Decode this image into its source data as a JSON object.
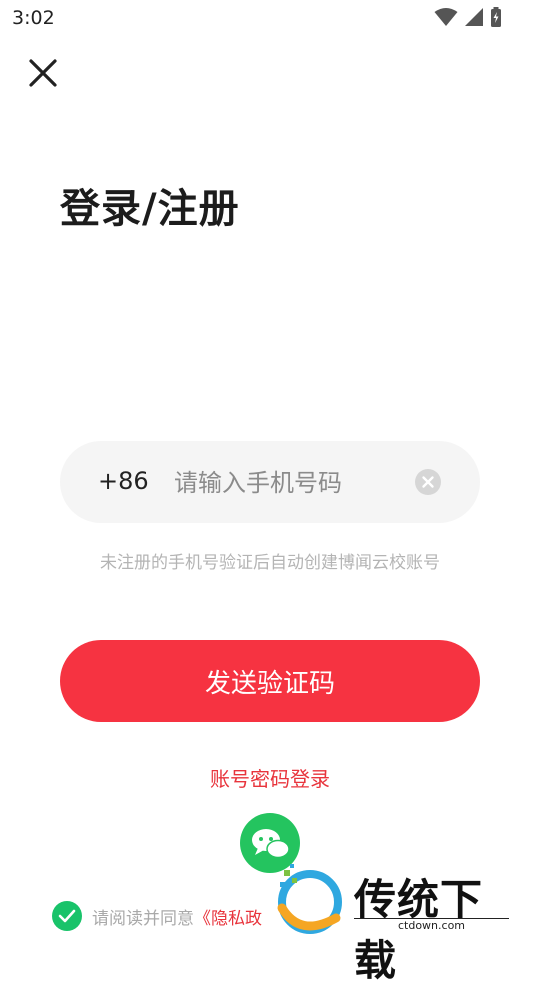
{
  "status_bar": {
    "time": "3:02"
  },
  "page": {
    "title": "登录/注册"
  },
  "phone": {
    "country_code": "+86",
    "placeholder": "请输入手机号码",
    "value": ""
  },
  "hint": "未注册的手机号验证后自动创建博闻云校账号",
  "actions": {
    "send_code": "发送验证码",
    "password_login": "账号密码登录"
  },
  "agreement": {
    "prefix": "请阅读并同意",
    "link": "《隐私政"
  },
  "watermark": {
    "brand": "传统下载",
    "site": "ctdown.com"
  },
  "colors": {
    "accent": "#f63341",
    "link": "#e8343c",
    "wechat": "#24c45f",
    "check": "#19c36a"
  },
  "icons": [
    "wifi-icon",
    "signal-icon",
    "battery-icon",
    "close-icon",
    "clear-icon",
    "wechat-icon",
    "check-icon"
  ]
}
